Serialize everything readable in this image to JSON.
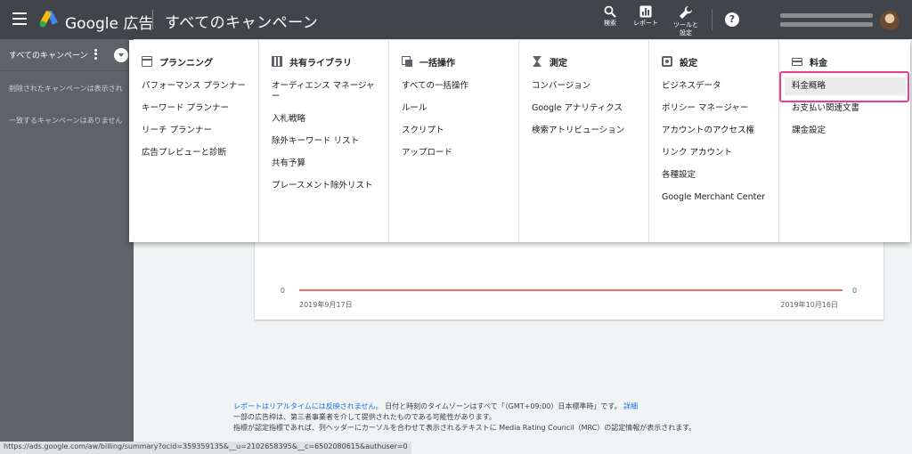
{
  "header": {
    "brand": "Google 広告",
    "page_title": "すべてのキャンペーン",
    "actions": [
      {
        "label": "検索",
        "icon": "search-icon"
      },
      {
        "label": "レポート",
        "icon": "reports-icon"
      },
      {
        "label": "ツールと\n設定",
        "icon": "wrench-icon"
      }
    ],
    "help_glyph": "?"
  },
  "sidebar": {
    "title": "すべてのキャンペーン",
    "notice": "削除されたキャンペーンは表示され",
    "empty_text": "一致するキャンペーンはありません"
  },
  "menu": {
    "columns": [
      {
        "title": "プランニング",
        "icon": "calendar-icon",
        "items": [
          "パフォーマンス プランナー",
          "キーワード プランナー",
          "リーチ プランナー",
          "広告プレビューと診断"
        ]
      },
      {
        "title": "共有ライブラリ",
        "icon": "library-icon",
        "items": [
          "オーディエンス マネージャー",
          "入札戦略",
          "除外キーワード リスト",
          "共有予算",
          "プレースメント除外リスト"
        ]
      },
      {
        "title": "一括操作",
        "icon": "bulk-actions-icon",
        "items": [
          "すべての一括操作",
          "ルール",
          "スクリプト",
          "アップロード"
        ]
      },
      {
        "title": "測定",
        "icon": "hourglass-icon",
        "items": [
          "コンバージョン",
          "Google アナリティクス",
          "検索アトリビューション"
        ]
      },
      {
        "title": "設定",
        "icon": "settings-icon",
        "items": [
          "ビジネスデータ",
          "ポリシー マネージャー",
          "アカウントのアクセス権",
          "リンク アカウント",
          "各種設定",
          "Google Merchant Center"
        ]
      },
      {
        "title": "料金",
        "icon": "credit-card-icon",
        "items": [
          "料金概略",
          "お支払い関連文書",
          "課金設定"
        ]
      }
    ]
  },
  "chart_data": {
    "type": "line",
    "x": [
      "2019年9月17日",
      "2019年10月16日"
    ],
    "series": [
      {
        "values": [
          0,
          0
        ],
        "color": "#db4437"
      }
    ],
    "left_axis_label": "0",
    "right_axis_label": "0"
  },
  "footer": {
    "line1_link": "レポートはリアルタイムには反映されません。",
    "line1_text": "日付と時刻のタイムゾーンはすべて「（GMT+09:00）日本標準時」です。",
    "line1_detail": "詳細",
    "line2": "一部の広告枠は、第三者事業者を介して提供されたものである可能性があります。",
    "line3": "指標が認定指標であれば、列ヘッダーにカーソルを合わせて表示されるテキストに Media Rating Council（MRC）の認定情報が表示されます。"
  },
  "status_url": "https://ads.google.com/aw/billing/summary?ocid=359359135&__u=2102658395&__c=6502080615&authuser=0",
  "colors": {
    "topbar": "#414549",
    "sidebar": "#5f6368",
    "highlight": "#e83e8c",
    "series": "#db4437",
    "link": "#1a73e8"
  }
}
